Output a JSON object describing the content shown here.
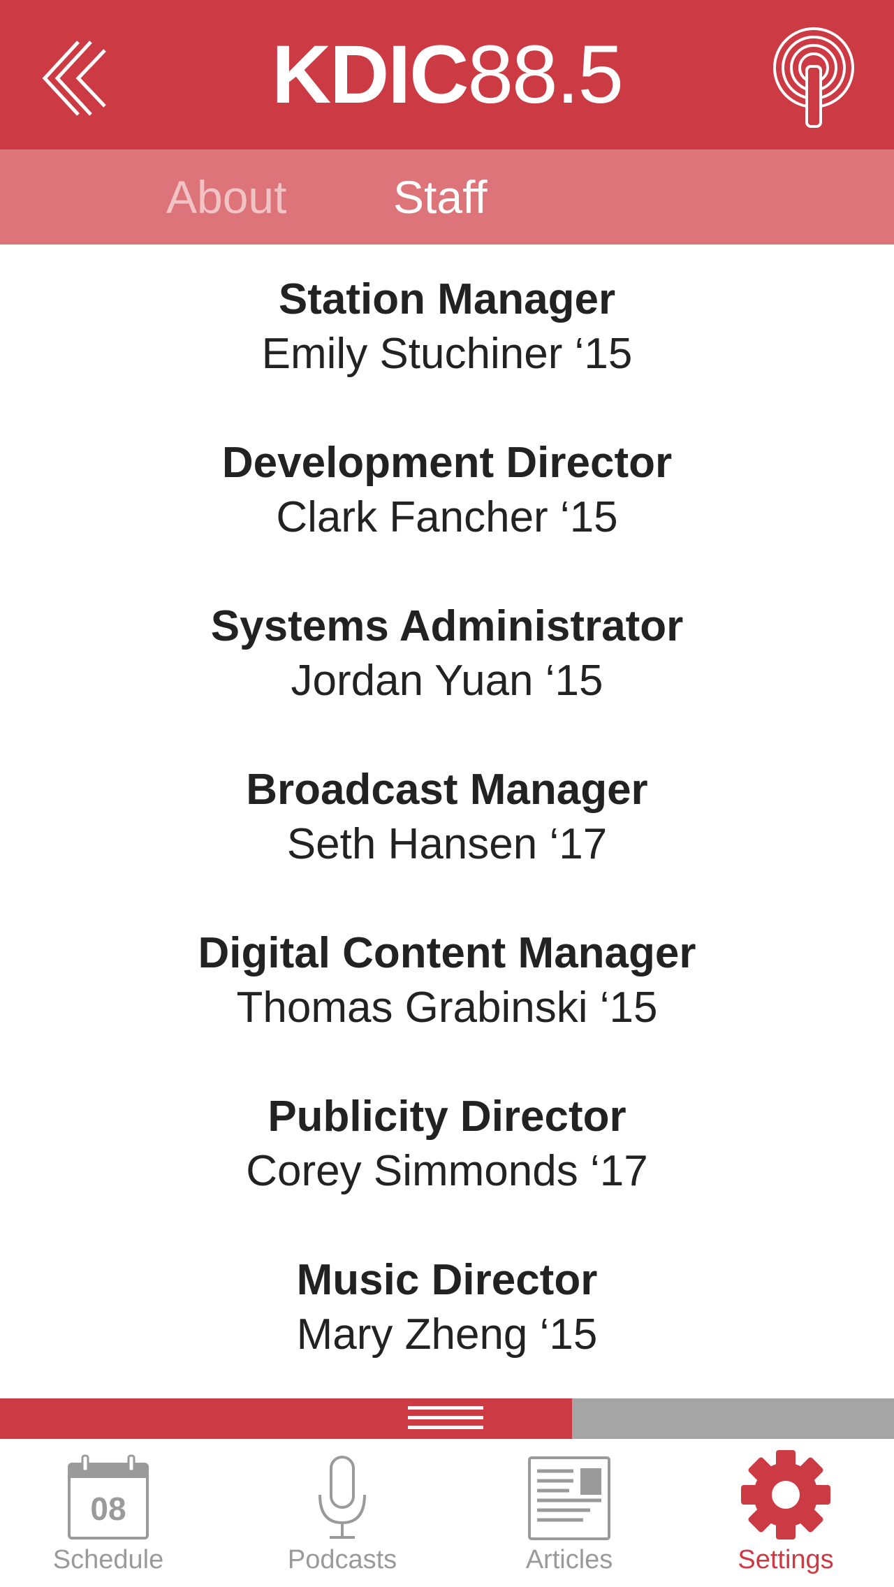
{
  "header": {
    "title_bold": "KDIC",
    "title_light": "88.5",
    "back_icon": "double-chevron-left-icon",
    "stream_icon": "radio-broadcast-icon"
  },
  "subtabs": [
    {
      "label": "About",
      "active": false
    },
    {
      "label": "Staff",
      "active": true
    }
  ],
  "staff": [
    {
      "role": "Station Manager",
      "name": "Emily Stuchiner ‘15"
    },
    {
      "role": "Development Director",
      "name": "Clark Fancher ‘15"
    },
    {
      "role": "Systems Administrator",
      "name": "Jordan Yuan ‘15"
    },
    {
      "role": "Broadcast Manager",
      "name": "Seth Hansen ‘17"
    },
    {
      "role": "Digital Content Manager",
      "name": "Thomas Grabinski ‘15"
    },
    {
      "role": "Publicity Director",
      "name": "Corey Simmonds ‘17"
    },
    {
      "role": "Music Director",
      "name": "Mary Zheng ‘15"
    }
  ],
  "player": {
    "progress": 0.64
  },
  "tabbar": {
    "schedule": {
      "label": "Schedule",
      "calendar_day": "08",
      "icon": "calendar-icon"
    },
    "podcasts": {
      "label": "Podcasts",
      "icon": "microphone-icon"
    },
    "articles": {
      "label": "Articles",
      "icon": "article-icon"
    },
    "settings": {
      "label": "Settings",
      "icon": "gear-icon",
      "active": true
    }
  },
  "colors": {
    "brand_red": "#cc3a43",
    "subtab_bg": "#dc7479",
    "inactive_gray": "#9a9a9a"
  }
}
